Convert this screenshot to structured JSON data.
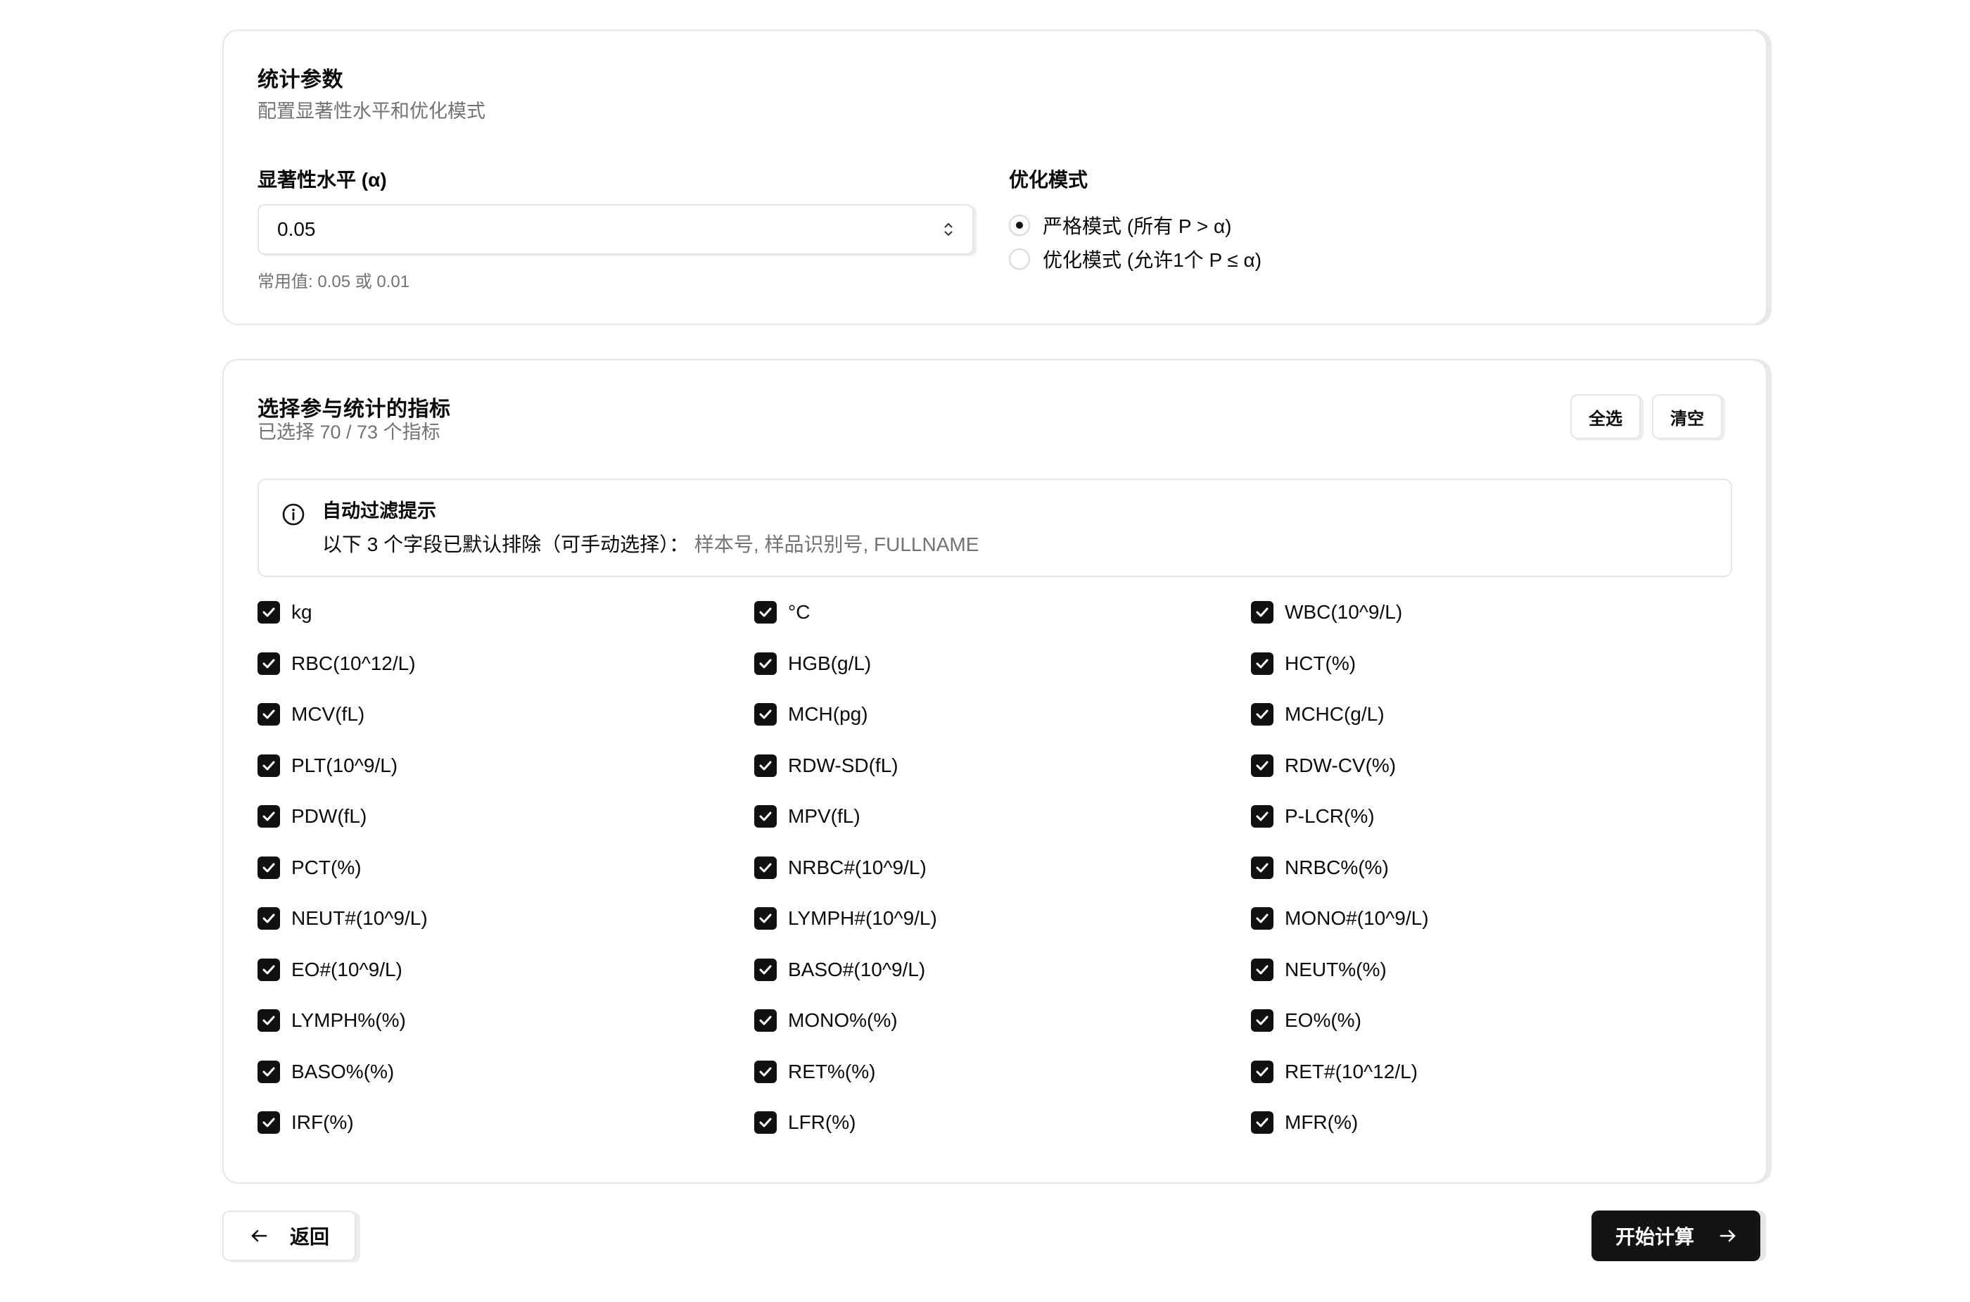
{
  "stats_card": {
    "title": "统计参数",
    "subtitle": "配置显著性水平和优化模式",
    "alpha_label": "显著性水平 (α)",
    "alpha_value": "0.05",
    "alpha_hint": "常用值: 0.05 或 0.01",
    "mode_label": "优化模式",
    "modes": [
      {
        "label": "严格模式 (所有 P > α)",
        "selected": true
      },
      {
        "label": "优化模式 (允许1个 P ≤ α)",
        "selected": false
      }
    ]
  },
  "indicator_card": {
    "title": "选择参与统计的指标",
    "subtitle": "已选择 70 / 73 个指标",
    "select_all_label": "全选",
    "clear_label": "清空",
    "info": {
      "title": "自动过滤提示",
      "text": "以下 3 个字段已默认排除（可手动选择）：",
      "excluded": "样本号, 样品识别号, FULLNAME"
    },
    "indicators": [
      {
        "label": "kg",
        "checked": true
      },
      {
        "label": "°C",
        "checked": true
      },
      {
        "label": "WBC(10^9/L)",
        "checked": true
      },
      {
        "label": "RBC(10^12/L)",
        "checked": true
      },
      {
        "label": "HGB(g/L)",
        "checked": true
      },
      {
        "label": "HCT(%)",
        "checked": true
      },
      {
        "label": "MCV(fL)",
        "checked": true
      },
      {
        "label": "MCH(pg)",
        "checked": true
      },
      {
        "label": "MCHC(g/L)",
        "checked": true
      },
      {
        "label": "PLT(10^9/L)",
        "checked": true
      },
      {
        "label": "RDW-SD(fL)",
        "checked": true
      },
      {
        "label": "RDW-CV(%)",
        "checked": true
      },
      {
        "label": "PDW(fL)",
        "checked": true
      },
      {
        "label": "MPV(fL)",
        "checked": true
      },
      {
        "label": "P-LCR(%)",
        "checked": true
      },
      {
        "label": "PCT(%)",
        "checked": true
      },
      {
        "label": "NRBC#(10^9/L)",
        "checked": true
      },
      {
        "label": "NRBC%(%)",
        "checked": true
      },
      {
        "label": "NEUT#(10^9/L)",
        "checked": true
      },
      {
        "label": "LYMPH#(10^9/L)",
        "checked": true
      },
      {
        "label": "MONO#(10^9/L)",
        "checked": true
      },
      {
        "label": "EO#(10^9/L)",
        "checked": true
      },
      {
        "label": "BASO#(10^9/L)",
        "checked": true
      },
      {
        "label": "NEUT%(%)",
        "checked": true
      },
      {
        "label": "LYMPH%(%)",
        "checked": true
      },
      {
        "label": "MONO%(%)",
        "checked": true
      },
      {
        "label": "EO%(%)",
        "checked": true
      },
      {
        "label": "BASO%(%)",
        "checked": true
      },
      {
        "label": "RET%(%)",
        "checked": true
      },
      {
        "label": "RET#(10^12/L)",
        "checked": true
      },
      {
        "label": "IRF(%)",
        "checked": true
      },
      {
        "label": "LFR(%)",
        "checked": true
      },
      {
        "label": "MFR(%)",
        "checked": true
      }
    ]
  },
  "footer": {
    "back_label": "返回",
    "start_label": "开始计算"
  }
}
